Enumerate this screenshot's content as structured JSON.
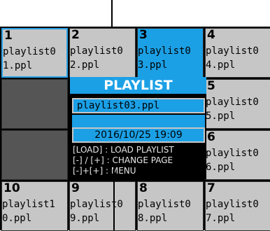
{
  "cells": {
    "c1": {
      "num": "1",
      "name": "playlist0",
      "ext": "1.ppl"
    },
    "c2": {
      "num": "2",
      "name": "playlist0",
      "ext": "2.ppl"
    },
    "c3": {
      "num": "3",
      "name": "playlist0",
      "ext": "3.ppl"
    },
    "c4": {
      "num": "4",
      "name": "playlist0",
      "ext": "4.ppl"
    },
    "c5": {
      "num": "5",
      "name": "playlist0",
      "ext": "5.ppl"
    },
    "c6": {
      "num": "6",
      "name": "playlist0",
      "ext": "6.ppl"
    },
    "c7": {
      "num": "7",
      "name": "playlist0",
      "ext": "7.ppl"
    },
    "c8": {
      "num": "8",
      "name": "playlist0",
      "ext": "8.ppl"
    },
    "c9": {
      "num": "9",
      "name": "playlist0",
      "ext": "9.ppl"
    },
    "c10": {
      "num": "10",
      "name": "playlist1",
      "ext": "0.ppl"
    }
  },
  "panel": {
    "title": "PLAYLIST",
    "file": "playlist03.ppl",
    "datetime": "2016/10/25 19:09",
    "help": [
      "[LOAD] : LOAD PLAYLIST",
      "[-] / [+] : CHANGE PAGE",
      "[-]+[+] : MENU"
    ]
  },
  "colors": {
    "accent": "#1ba0e6",
    "cell": "#c6c6c6",
    "empty_cell": "#555555",
    "background": "#000000"
  }
}
